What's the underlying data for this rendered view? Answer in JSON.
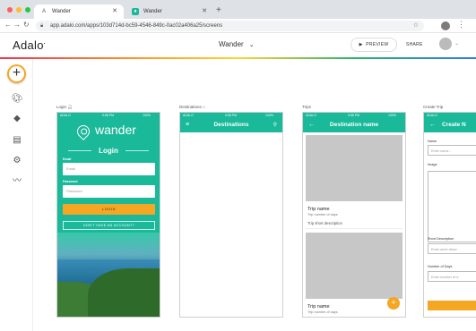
{
  "browser": {
    "tabs": [
      {
        "label": "Wander",
        "favicon": "adalo-icon"
      },
      {
        "label": "Wander",
        "favicon": "wander-icon"
      }
    ],
    "url": "app.adalo.com/apps/103d714d-bc59-4546-849c-0ac02a406a25/screens",
    "traffic_colors": [
      "#fe5f57",
      "#febc2e",
      "#28c840"
    ]
  },
  "app": {
    "logo": "Adalo",
    "title": "Wander",
    "preview_label": "PREVIEW",
    "share_label": "SHARE"
  },
  "toolbar": {
    "items": [
      "add-icon",
      "palette-icon",
      "layers-icon",
      "screens-icon",
      "settings-icon",
      "analytics-icon"
    ],
    "add_glyph": "+"
  },
  "screens": {
    "login": {
      "label": "Login",
      "status": {
        "carrier": "ADALO",
        "time": "9:58 PM",
        "battery": "100%"
      },
      "brand": "wander",
      "heading": "Login",
      "email_label": "Email",
      "email_placeholder": "Email",
      "password_label": "Password",
      "password_placeholder": "Password",
      "login_button": "LOGIN",
      "account_button": "DON'T HAVE AN ACCOUNT?"
    },
    "destinations": {
      "label": "Destinations",
      "status": {
        "carrier": "ADALO",
        "time": "9:58 PM",
        "battery": "100%"
      },
      "header_title": "Destinations"
    },
    "trips": {
      "label": "Trips",
      "status": {
        "carrier": "ADALO",
        "time": "9:58 PM",
        "battery": "100%"
      },
      "header_title": "Destination name",
      "cards": [
        {
          "name": "Trip name",
          "days": "Trip number of days",
          "desc": "Trip short description"
        },
        {
          "name": "Trip name",
          "days": "Trip number of days",
          "desc": ""
        }
      ],
      "fab_glyph": "+"
    },
    "create_trip": {
      "label": "Create Trip",
      "status": {
        "carrier": "ADALO"
      },
      "header_title": "Create N",
      "name_label": "Name",
      "name_placeholder": "Enter name...",
      "image_label": "Image",
      "desc_label": "Short Description",
      "desc_placeholder": "Enter short descr",
      "days_label": "Number of Days",
      "days_placeholder": "Enter number of d"
    }
  },
  "colors": {
    "primary": "#1ab99a",
    "accent": "#f5a623"
  }
}
